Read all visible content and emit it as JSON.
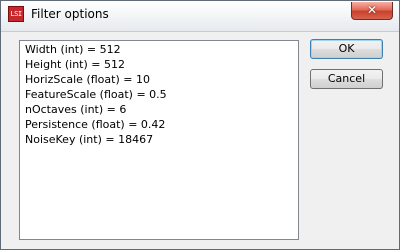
{
  "window": {
    "title": "Filter options",
    "icon_text": "LSI",
    "close_symbol": "✕"
  },
  "parameters": [
    "Width (int) = 512",
    "Height (int) = 512",
    "HorizScale (float) = 10",
    "FeatureScale (float) = 0.5",
    "nOctaves (int) = 6",
    "Persistence (float) = 0.42",
    "NoiseKey (int) = 18467"
  ],
  "buttons": {
    "ok": "OK",
    "cancel": "Cancel"
  }
}
